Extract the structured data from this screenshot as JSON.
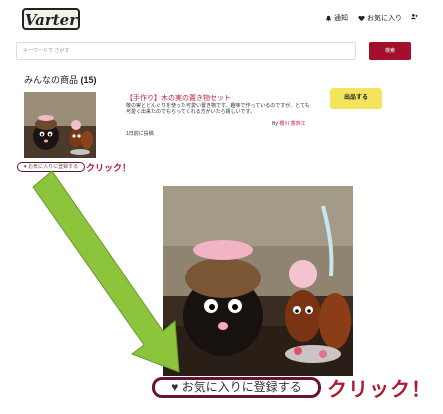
{
  "header": {
    "logo": "Varter",
    "notify_label": "通知",
    "favorites_label": "お気に入り"
  },
  "search": {
    "placeholder": "キーワードで さがす",
    "button_label": "検索"
  },
  "section": {
    "title": "みんなの商品",
    "count": "(15)"
  },
  "product": {
    "title": "【手作り】木の実の置き物セット",
    "description": "敬の実とどんぐりを使った可愛い置き物です。趣味で作っているのですが、とても可愛く出来たのでもらってくれる方がいたら嬉しいです。",
    "time": "1日前に投稿",
    "by_prefix": "By",
    "author": "橋川 香奈江",
    "list_button": "出品する",
    "fav_button": "お気に入りに登録する"
  },
  "annotations": {
    "click_small": "クリック！",
    "click_big": "クリック！",
    "fav_big": "お気に入りに登録する"
  },
  "colors": {
    "accent": "#a3102c",
    "highlight_border": "#6a1230",
    "list_button": "#f4e35c",
    "arrow": "#8cc43c"
  }
}
